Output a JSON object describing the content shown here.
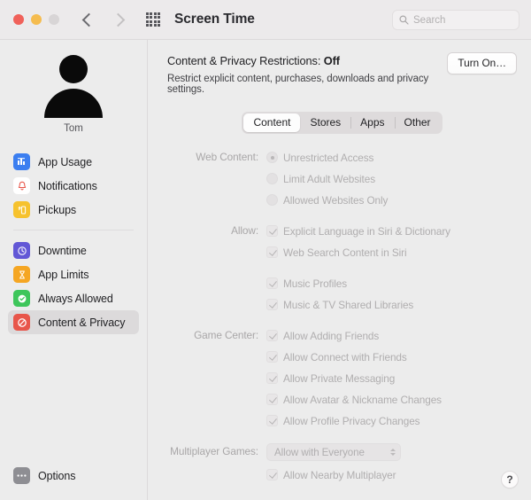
{
  "window": {
    "title": "Screen Time",
    "traffic_lights": [
      "close",
      "minimize",
      "zoom"
    ],
    "back_label": "Back",
    "forward_label": "Forward",
    "grid_label": "Show All Preferences"
  },
  "search": {
    "placeholder": "Search",
    "value": "",
    "icon": "search-icon"
  },
  "sidebar": {
    "user": {
      "name": "Tom",
      "avatar_icon": "person-silhouette-icon"
    },
    "group_one": [
      {
        "label": "App Usage",
        "icon": "chart-bar-icon",
        "color": "#3b7ef0",
        "selected": false
      },
      {
        "label": "Notifications",
        "icon": "bell-icon",
        "color": "#ffffff",
        "selected": false
      },
      {
        "label": "Pickups",
        "icon": "hand-phone-icon",
        "color": "#f6c22e",
        "selected": false
      }
    ],
    "group_two": [
      {
        "label": "Downtime",
        "icon": "clock-icon",
        "color": "#6257d6",
        "selected": false
      },
      {
        "label": "App Limits",
        "icon": "hourglass-icon",
        "color": "#f5a623",
        "selected": false
      },
      {
        "label": "Always Allowed",
        "icon": "checkmark-seal-icon",
        "color": "#3ec65b",
        "selected": false
      },
      {
        "label": "Content & Privacy",
        "icon": "prohibition-icon",
        "color": "#e8564a",
        "selected": true
      }
    ],
    "bottom": [
      {
        "label": "Options",
        "icon": "ellipsis-icon",
        "color": "#8e8e93",
        "selected": false
      }
    ]
  },
  "content": {
    "restrictions_label": "Content & Privacy Restrictions:",
    "restrictions_state": "Off",
    "description": "Restrict explicit content, purchases, downloads and privacy settings.",
    "turn_on_button": "Turn On…",
    "tabs": [
      {
        "label": "Content",
        "active": true
      },
      {
        "label": "Stores",
        "active": false
      },
      {
        "label": "Apps",
        "active": false
      },
      {
        "label": "Other",
        "active": false
      }
    ],
    "web_content": {
      "label": "Web Content:",
      "options": [
        {
          "label": "Unrestricted Access",
          "checked": true
        },
        {
          "label": "Limit Adult Websites",
          "checked": false
        },
        {
          "label": "Allowed Websites Only",
          "checked": false
        }
      ]
    },
    "allow": {
      "label": "Allow:",
      "group_a": [
        {
          "label": "Explicit Language in Siri & Dictionary",
          "checked": true
        },
        {
          "label": "Web Search Content in Siri",
          "checked": true
        }
      ],
      "group_b": [
        {
          "label": "Music Profiles",
          "checked": true
        },
        {
          "label": "Music & TV Shared Libraries",
          "checked": true
        }
      ]
    },
    "game_center": {
      "label": "Game Center:",
      "options": [
        {
          "label": "Allow Adding Friends",
          "checked": true
        },
        {
          "label": "Allow Connect with Friends",
          "checked": true
        },
        {
          "label": "Allow Private Messaging",
          "checked": true
        },
        {
          "label": "Allow Avatar & Nickname Changes",
          "checked": true
        },
        {
          "label": "Allow Profile Privacy Changes",
          "checked": true
        }
      ]
    },
    "multiplayer": {
      "label": "Multiplayer Games:",
      "selected": "Allow with Everyone",
      "nearby": {
        "label": "Allow Nearby Multiplayer",
        "checked": true
      }
    },
    "help_button": "?"
  },
  "colors": {
    "window_bg": "#ececec",
    "titlebar_bg": "#eceaeb",
    "selection_bg": "#dcdadb",
    "disabled_text": "#b0aeaf",
    "label_text": "#a9a7a8"
  }
}
